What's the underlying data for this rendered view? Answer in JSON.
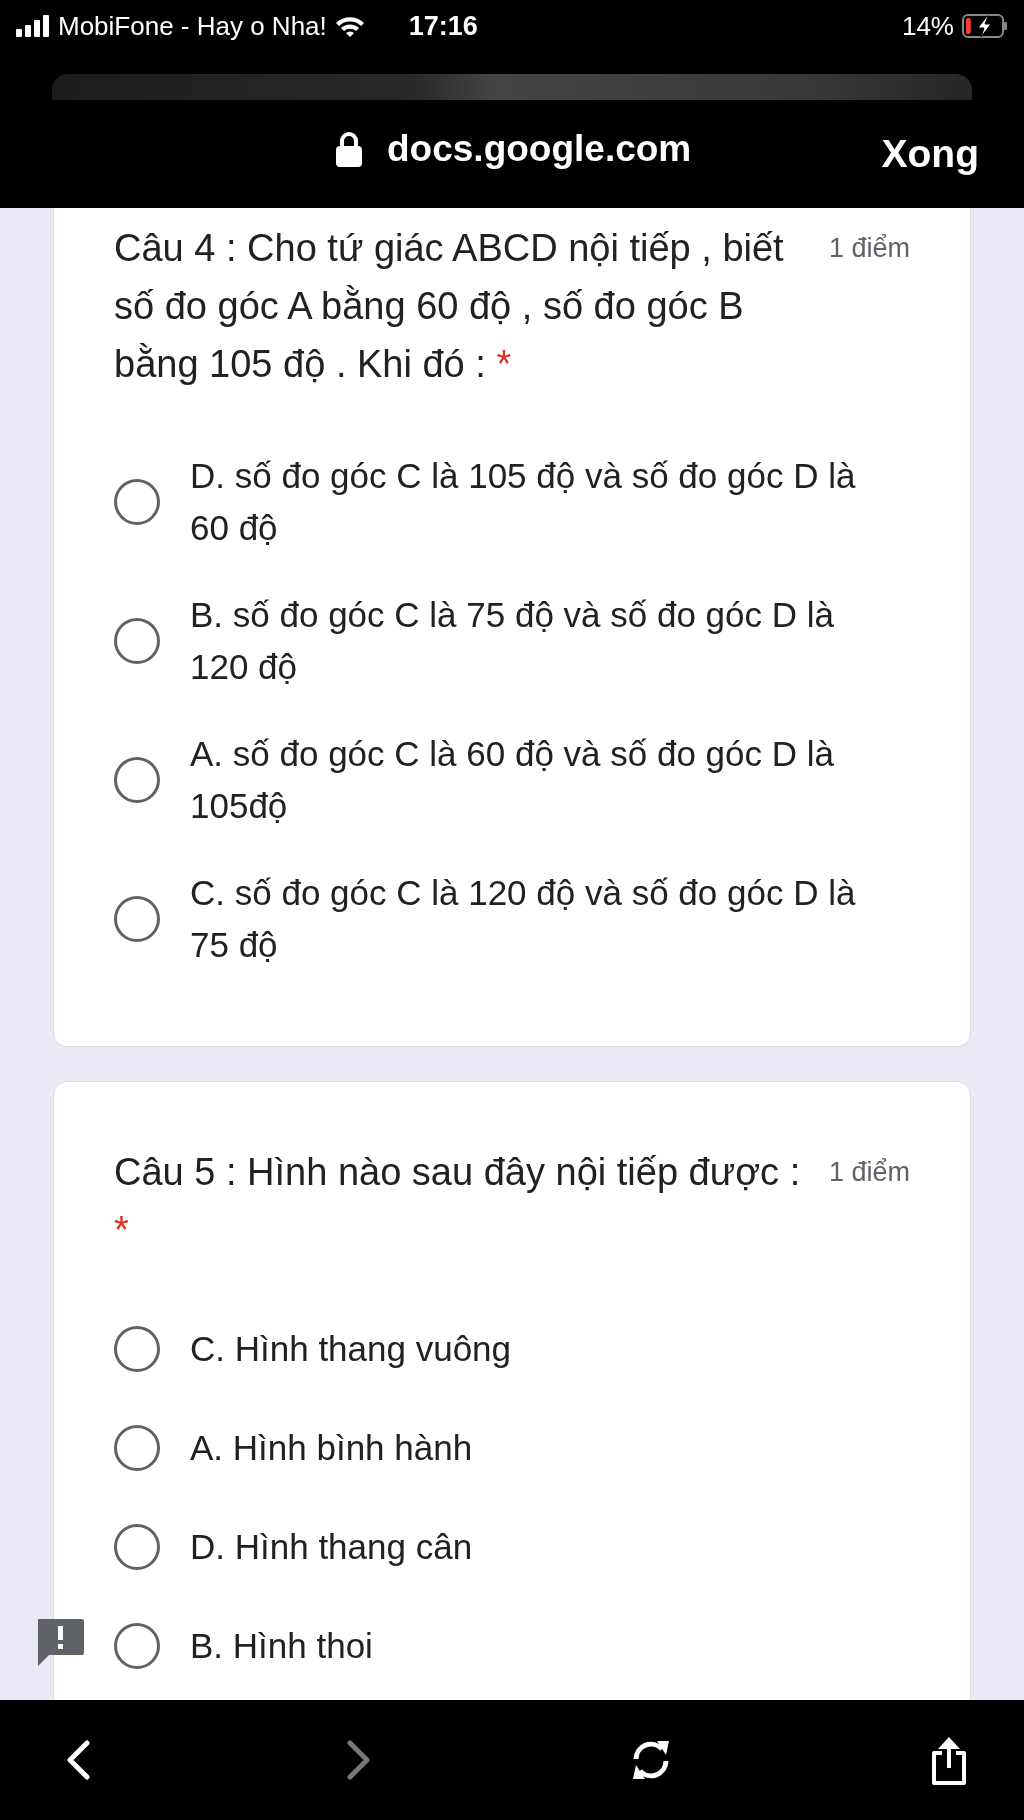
{
  "status_bar": {
    "carrier": "MobiFone - Hay o Nha!",
    "time": "17:16",
    "battery": "14%",
    "charging": true
  },
  "address_bar": {
    "url": "docs.google.com",
    "done_button": "Xong"
  },
  "questions": [
    {
      "title": "Câu 4 : Cho tứ giác ABCD nội tiếp , biết số đo góc A bằng 60 độ , số đo góc B bằng 105 độ . Khi đó :",
      "required_mark": "*",
      "points": "1 điểm",
      "top_cut": true,
      "options": [
        {
          "label": "D. số đo góc C là 105 độ và số đo góc D là 60 độ",
          "selected": false
        },
        {
          "label": "B. số đo góc C là 75 độ và số đo góc D là 120 độ",
          "selected": false
        },
        {
          "label": "A. số đo góc C là 60 độ và số đo góc D là 105độ",
          "selected": false
        },
        {
          "label": "C. số đo góc C là 120 độ và số đo góc D là 75 độ",
          "selected": false
        }
      ]
    },
    {
      "title": "Câu 5 : Hình nào sau đây nội tiếp được :",
      "required_mark": "*",
      "points": "1 điểm",
      "top_cut": false,
      "options": [
        {
          "label": "C. Hình thang vuông",
          "selected": false
        },
        {
          "label": "A. Hình bình hành",
          "selected": false
        },
        {
          "label": "D. Hình thang cân",
          "selected": false
        },
        {
          "label": "B. Hình thoi",
          "selected": false
        }
      ]
    }
  ],
  "toolbar": {
    "back_enabled": true,
    "forward_enabled": false
  }
}
